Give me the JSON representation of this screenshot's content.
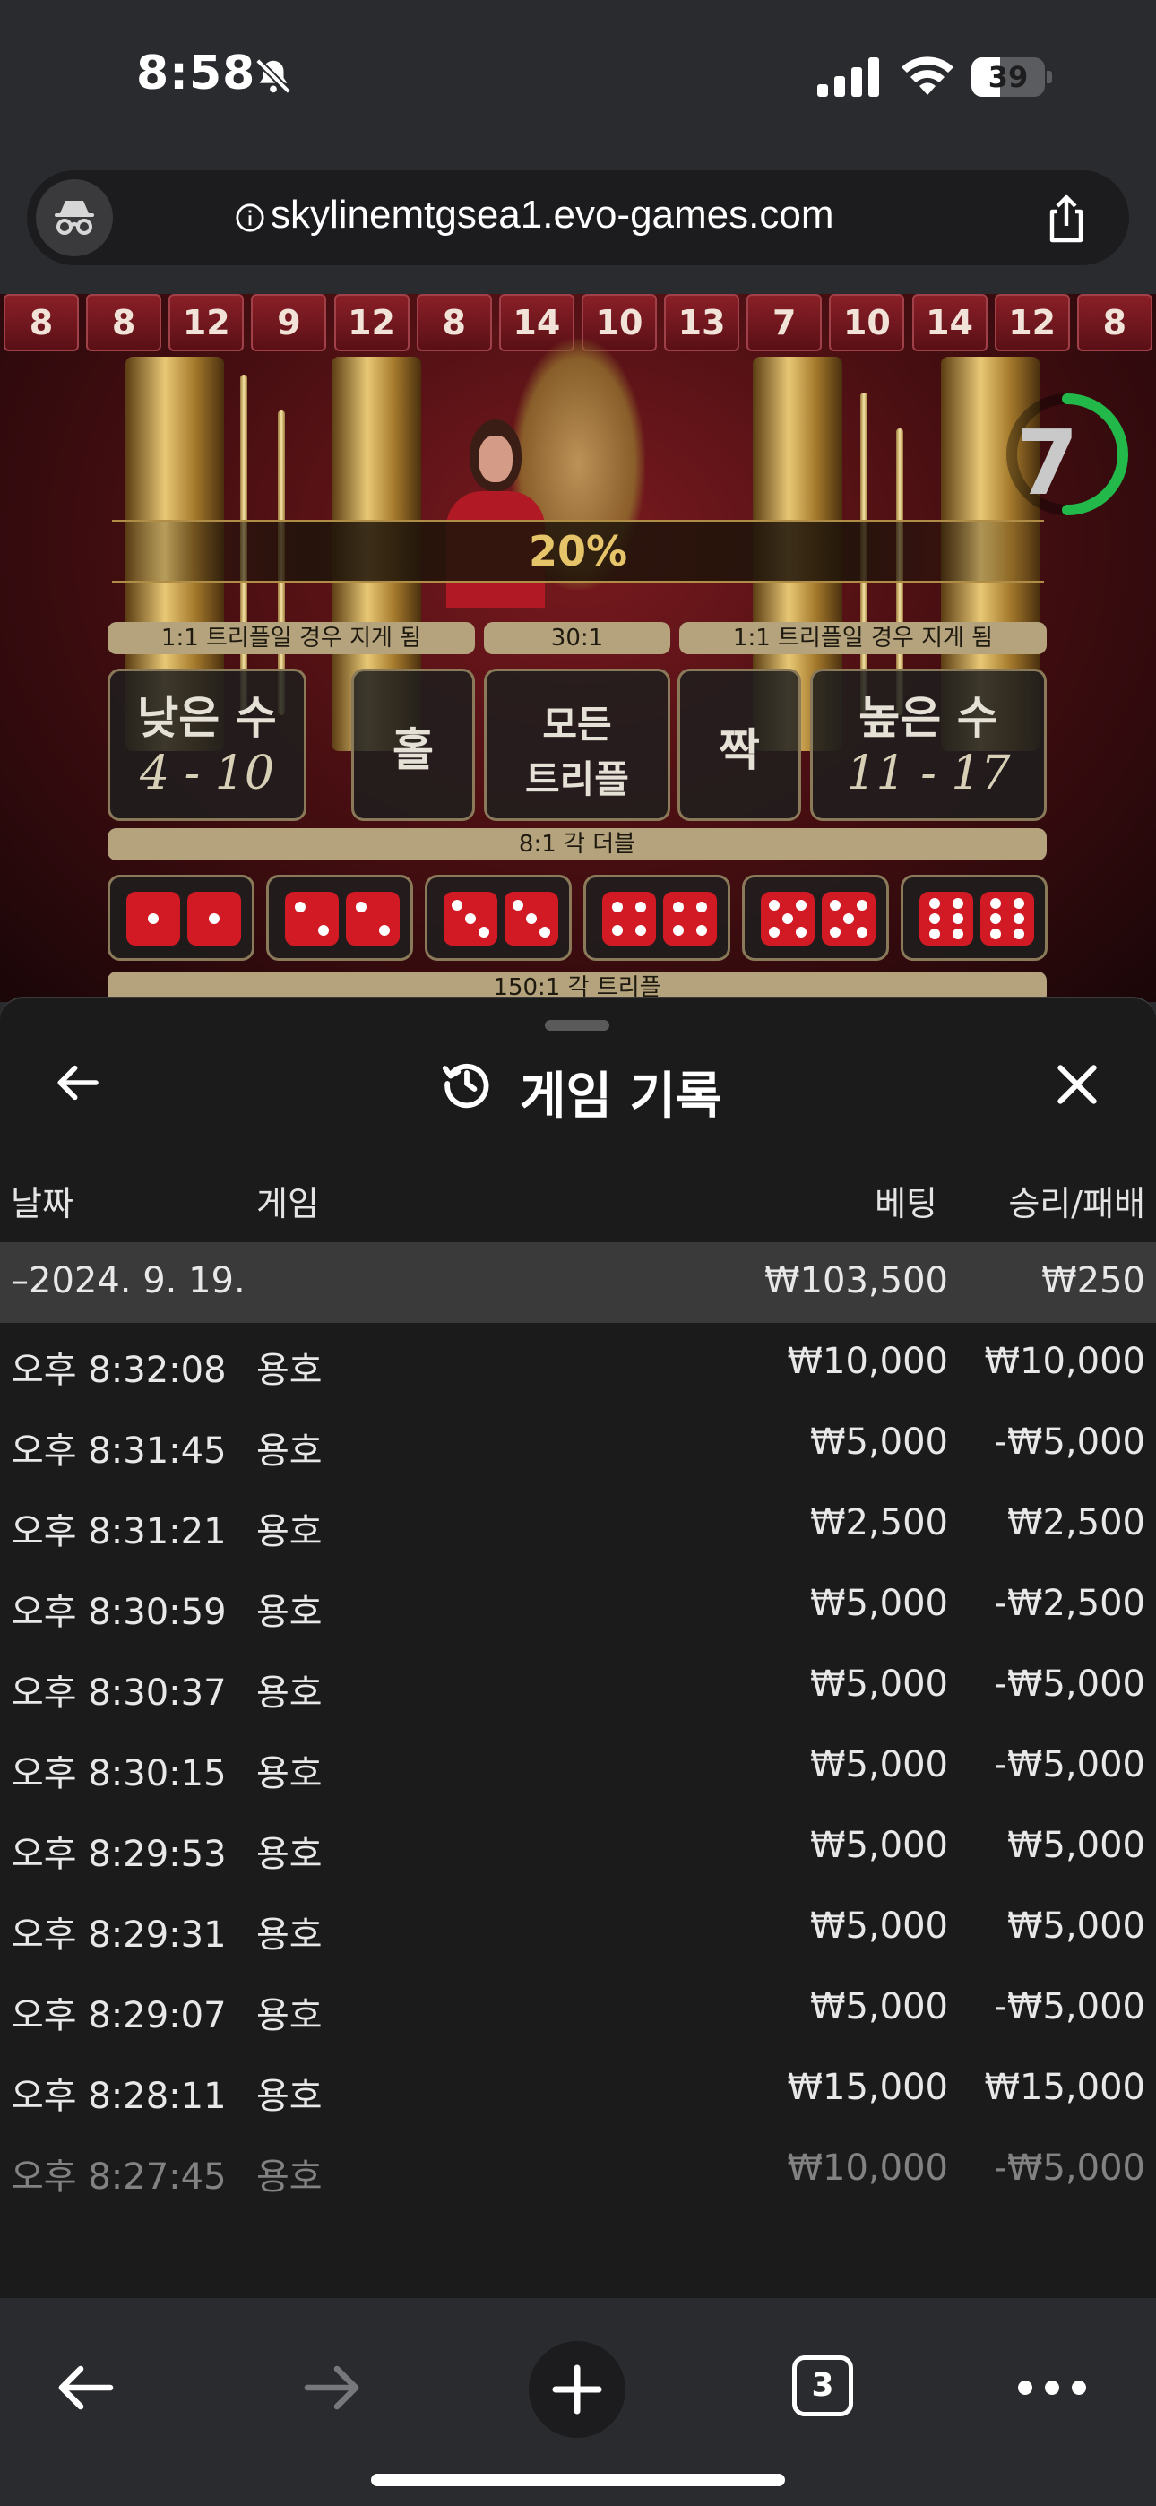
{
  "status_bar": {
    "time": "8:58",
    "battery_percent": "39",
    "battery_level": 0.39
  },
  "browser": {
    "url": "skylinemtgsea1.evo-games.com",
    "open_tabs": "3"
  },
  "game": {
    "number_strip": [
      "8",
      "8",
      "12",
      "9",
      "12",
      "8",
      "14",
      "10",
      "13",
      "7",
      "10",
      "14",
      "12",
      "8"
    ],
    "timer_value": "7",
    "multiplier": "20%",
    "payouts": {
      "left": "1:1 트리플일 경우 지게 됨",
      "center": "30:1",
      "right": "1:1 트리플일 경우 지게 됨",
      "double": "8:1 각 더블",
      "triple": "150:1 각 트리플"
    },
    "bets": {
      "small_label": "낮은 수",
      "small_range": "4 - 10",
      "odd": "홀",
      "any_triple_line1": "모든",
      "any_triple_line2": "트리플",
      "even": "짝",
      "big_label": "높은 수",
      "big_range": "11 - 17"
    },
    "doubles": [
      1,
      2,
      3,
      4,
      5,
      6
    ],
    "colors": {
      "felt": "#7a1a1f",
      "gold": "#e6c46a",
      "timer_green": "#22b84a"
    }
  },
  "history": {
    "title": "게임 기록",
    "columns": {
      "date": "날짜",
      "game": "게임",
      "bet": "베팅",
      "winloss": "승리/패배"
    },
    "summary": {
      "date": "–2024. 9. 19.",
      "bet": "₩103,500",
      "winloss": "₩250"
    },
    "rows": [
      {
        "time": "오후 8:32:08",
        "game": "용호",
        "bet": "₩10,000",
        "winloss": "₩10,000"
      },
      {
        "time": "오후 8:31:45",
        "game": "용호",
        "bet": "₩5,000",
        "winloss": "-₩5,000"
      },
      {
        "time": "오후 8:31:21",
        "game": "용호",
        "bet": "₩2,500",
        "winloss": "₩2,500"
      },
      {
        "time": "오후 8:30:59",
        "game": "용호",
        "bet": "₩5,000",
        "winloss": "-₩2,500"
      },
      {
        "time": "오후 8:30:37",
        "game": "용호",
        "bet": "₩5,000",
        "winloss": "-₩5,000"
      },
      {
        "time": "오후 8:30:15",
        "game": "용호",
        "bet": "₩5,000",
        "winloss": "-₩5,000"
      },
      {
        "time": "오후 8:29:53",
        "game": "용호",
        "bet": "₩5,000",
        "winloss": "₩5,000"
      },
      {
        "time": "오후 8:29:31",
        "game": "용호",
        "bet": "₩5,000",
        "winloss": "₩5,000"
      },
      {
        "time": "오후 8:29:07",
        "game": "용호",
        "bet": "₩5,000",
        "winloss": "-₩5,000"
      },
      {
        "time": "오후 8:28:11",
        "game": "용호",
        "bet": "₩15,000",
        "winloss": "₩15,000"
      },
      {
        "time": "오후 8:27:45",
        "game": "용호",
        "bet": "₩10,000",
        "winloss": "-₩5,000"
      }
    ]
  }
}
